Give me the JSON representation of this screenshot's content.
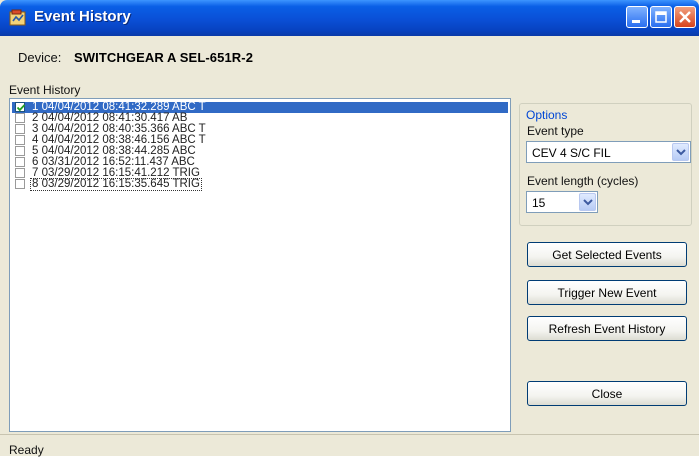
{
  "window": {
    "title": "Event History",
    "icon": "app-icon"
  },
  "device": {
    "label": "Device:",
    "value": "SWITCHGEAR A  SEL-651R-2"
  },
  "event_history": {
    "label": "Event History",
    "rows": [
      {
        "text": "1  04/04/2012 08:41:32.289 ABC T",
        "checked": true,
        "selected": true
      },
      {
        "text": "2  04/04/2012 08:41:30.417 AB",
        "checked": false
      },
      {
        "text": "3  04/04/2012 08:40:35.366 ABC T",
        "checked": false
      },
      {
        "text": "4  04/04/2012 08:38:46.156 ABC T",
        "checked": false
      },
      {
        "text": "5  04/04/2012 08:38:44.285 ABC",
        "checked": false
      },
      {
        "text": "6  03/31/2012 16:52:11.437 ABC",
        "checked": false
      },
      {
        "text": "7  03/29/2012 16:15:41.212 TRIG",
        "checked": false
      },
      {
        "text": "8  03/29/2012 16:15:35.645 TRIG",
        "checked": false,
        "focused": true
      }
    ]
  },
  "options": {
    "title": "Options",
    "event_type_label": "Event type",
    "event_type_value": "CEV 4 S/C FIL",
    "event_length_label": "Event length (cycles)",
    "event_length_value": "15"
  },
  "buttons": {
    "get_selected": "Get Selected Events",
    "trigger_new": "Trigger New Event",
    "refresh": "Refresh Event History",
    "close": "Close"
  },
  "status": {
    "text": "Ready"
  },
  "colors": {
    "titlebar": "#0a4fd6",
    "selection": "#316ac5",
    "options_title": "#0046d5"
  }
}
